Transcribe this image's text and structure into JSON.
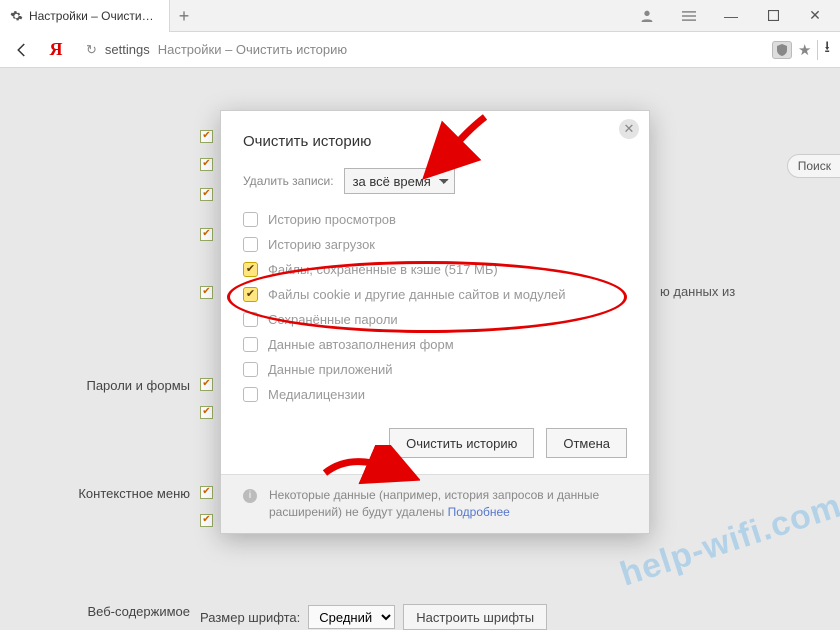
{
  "window": {
    "tab_title": "Настройки – Очистить ис",
    "user_icon": "user-icon"
  },
  "toolbar": {
    "reload_icon": "↻",
    "url_scheme": "settings",
    "url_title": "Настройки – Очистить историю",
    "shield_icon": "shield",
    "star_icon": "★",
    "download_icon": "↓"
  },
  "bg": {
    "search_label": "Поиск",
    "text_snippet": "ю данных из",
    "section_passwords": "Пароли и формы",
    "section_context": "Контекстное меню",
    "section_web": "Веб-содержимое",
    "font_size_label": "Размер шрифта:",
    "font_size_value": "Средний",
    "font_settings_btn": "Настроить шрифты"
  },
  "modal": {
    "title": "Очистить историю",
    "range_label": "Удалить записи:",
    "range_value": "за всё время",
    "options": [
      {
        "label": "Историю просмотров",
        "checked": false
      },
      {
        "label": "Историю загрузок",
        "checked": false
      },
      {
        "label": "Файлы, сохранённые в кэше (517 МБ)",
        "checked": true
      },
      {
        "label": "Файлы cookie и другие данные сайтов и модулей",
        "checked": true
      },
      {
        "label": "Сохранённые пароли",
        "checked": false
      },
      {
        "label": "Данные автозаполнения форм",
        "checked": false
      },
      {
        "label": "Данные приложений",
        "checked": false
      },
      {
        "label": "Медиалицензии",
        "checked": false
      }
    ],
    "submit": "Очистить историю",
    "cancel": "Отмена",
    "footer_text": "Некоторые данные (например, история запросов и данные расширений) не будут удалены ",
    "footer_link": "Подробнее"
  },
  "watermark": "help-wifi.com"
}
